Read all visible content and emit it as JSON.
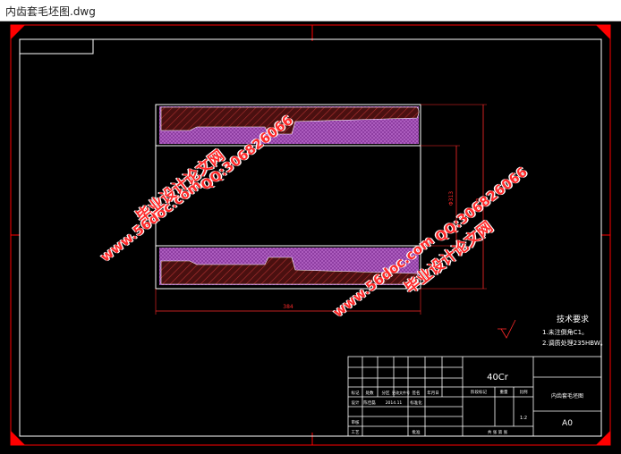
{
  "window": {
    "title": "内齿套毛坯图.dwg"
  },
  "drawing": {
    "dim_length": "384",
    "dim_bore": "Φ313",
    "dim_outer": "Φ"
  },
  "technical_requirements": {
    "heading": "技术要求",
    "lines": [
      "1.未注倒角C1。",
      "2.调质处理235HBW。"
    ]
  },
  "title_block": {
    "material": "40Cr",
    "part_name": "内齿套毛坯图",
    "sheet_code": "A0",
    "scale": "1:2",
    "headers": [
      "标记",
      "处数",
      "分区",
      "更改文件号",
      "签名",
      "年月日"
    ],
    "row_design": [
      "设计",
      "陈佳磊",
      "2014.11",
      "标准化"
    ],
    "stage_headers": [
      "阶段标记",
      "重量",
      "比例"
    ],
    "row_review": "审核",
    "row_process": "工艺",
    "row_approve": "批准",
    "sheet_info": "共  张  第  张"
  },
  "watermarks": {
    "site_a": "www.56doc.com",
    "brand_a": "毕业设计论文网",
    "qq_a": "QQ:306826066",
    "site_b": "www.56doc.com",
    "brand_b": "毕业设计论文网",
    "qq_b": "QQ:306826066"
  },
  "colors": {
    "frame": "#ff0000",
    "outline": "#ffffff",
    "section_fill": "#7b2f8c",
    "hatch": "#6b1f1f",
    "dimension": "#ff2a2a"
  }
}
